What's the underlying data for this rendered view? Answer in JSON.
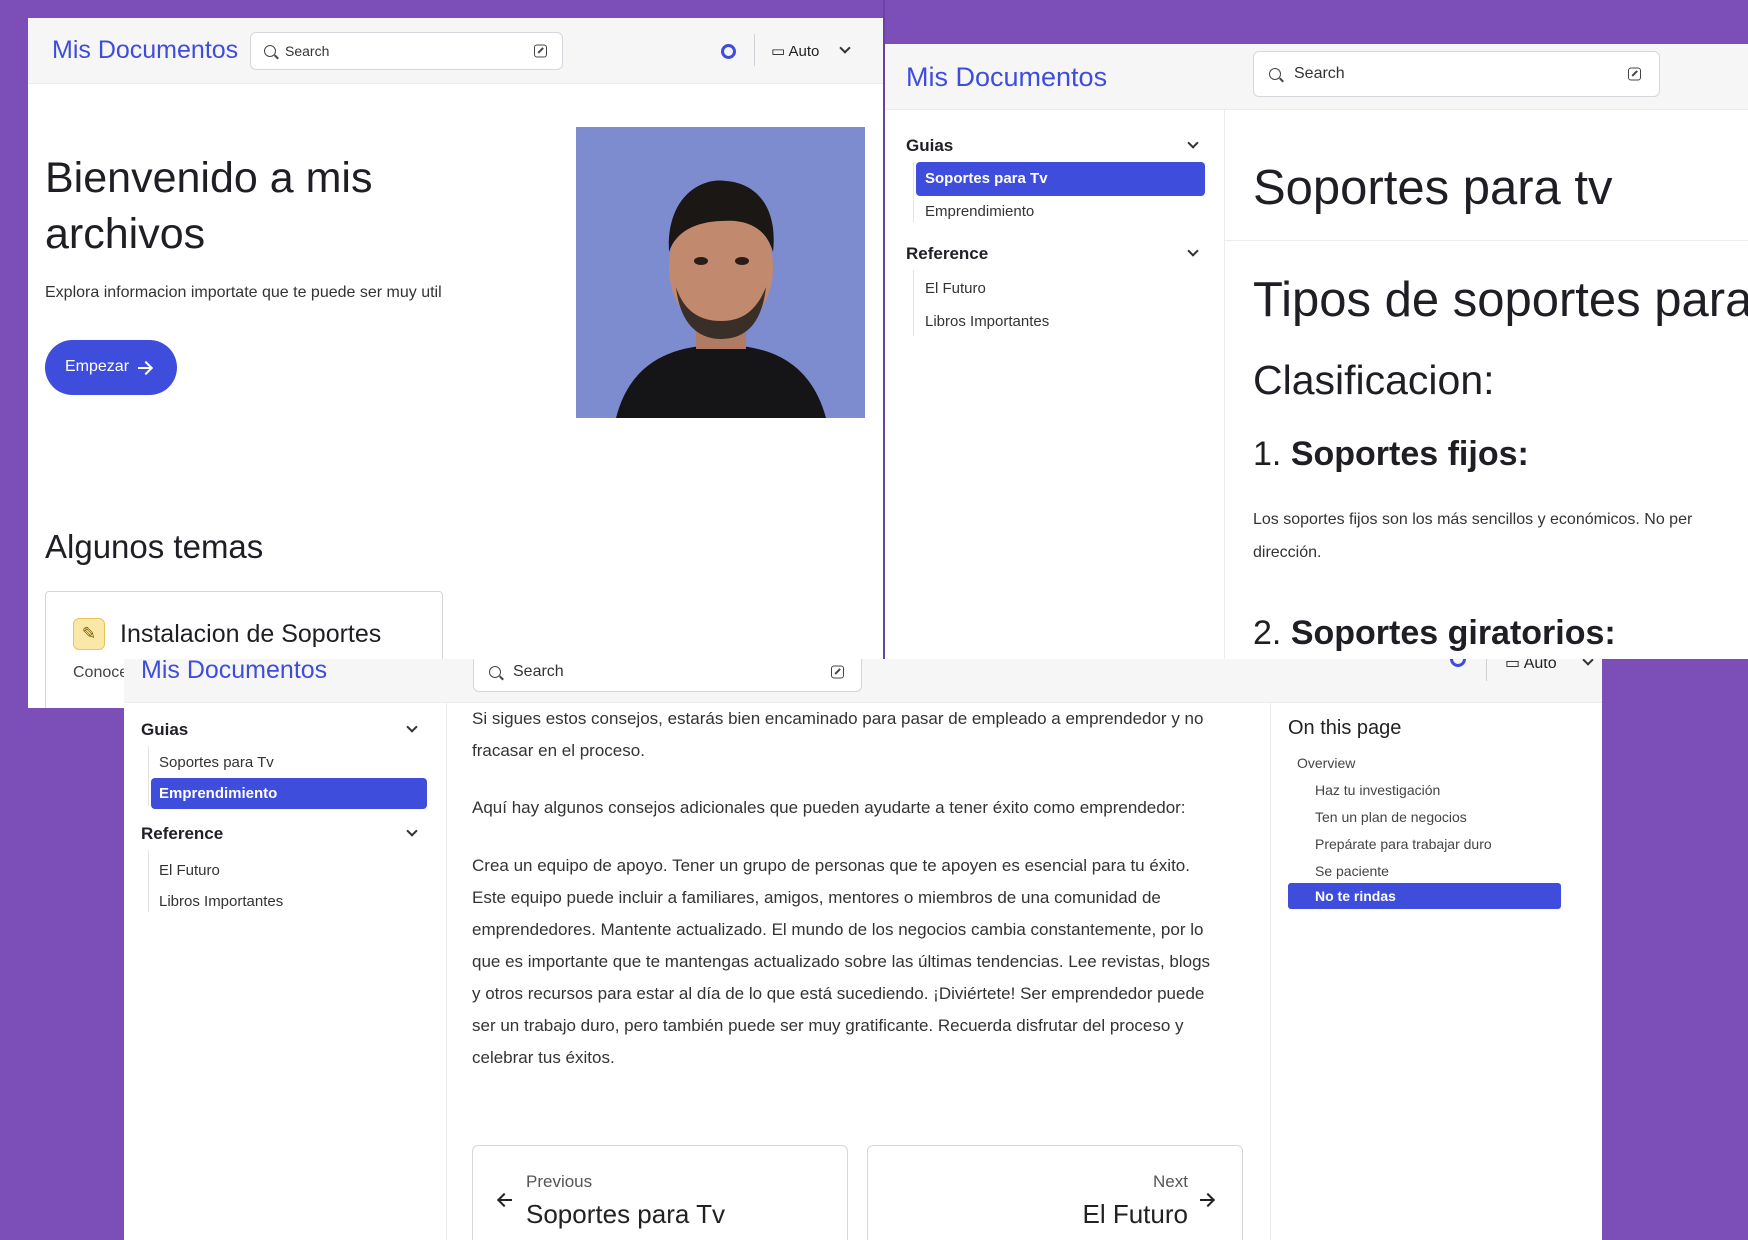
{
  "brand": "Mis Documentos",
  "search_placeholder": "Search",
  "theme_label": "Auto",
  "home": {
    "hero_title_line1": "Bienvenido a mis",
    "hero_title_line2": "archivos",
    "hero_subtitle": "Explora informacion importate que te puede ser muy util",
    "cta_label": "Empezar",
    "section_title": "Algunos temas",
    "card_title": "Instalacion de Soportes",
    "card_text": "Conoce"
  },
  "sidebar": {
    "groups": [
      {
        "label": "Guias",
        "items": [
          "Soportes para Tv",
          "Emprendimiento"
        ]
      },
      {
        "label": "Reference",
        "items": [
          "El Futuro",
          "Libros Importantes"
        ]
      }
    ]
  },
  "tv_page": {
    "title": "Soportes para tv",
    "h1": "Tipos de soportes para",
    "h2": "Clasificacion:",
    "h3_1_num": "1.",
    "h3_1_text": "Soportes fijos:",
    "p1_line1": "Los soportes fijos son los más sencillos y económicos. No per",
    "p1_line2": "dirección.",
    "h3_2_num": "2.",
    "h3_2_text": "Soportes giratorios:"
  },
  "emp_page": {
    "p1_line1": "Si sigues estos consejos, estarás bien encaminado para pasar de empleado a emprendedor y no",
    "p1_line2": "fracasar en el proceso.",
    "p2": "Aquí hay algunos consejos adicionales que pueden ayudarte a tener éxito como emprendedor:",
    "p3_lines": [
      "Crea un equipo de apoyo. Tener un grupo de personas que te apoyen es esencial para tu éxito.",
      "Este equipo puede incluir a familiares, amigos, mentores o miembros de una comunidad de",
      "emprendedores. Mantente actualizado. El mundo de los negocios cambia constantemente, por lo",
      "que es importante que te mantengas actualizado sobre las últimas tendencias. Lee revistas, blogs",
      "y otros recursos para estar al día de lo que está sucediendo. ¡Diviértete! Ser emprendedor puede",
      "ser un trabajo duro, pero también puede ser muy gratificante. Recuerda disfrutar del proceso y",
      "celebrar tus éxitos."
    ],
    "prev_label": "Previous",
    "prev_title": "Soportes para Tv",
    "next_label": "Next",
    "next_title": "El Futuro"
  },
  "toc": {
    "title": "On this page",
    "items": [
      "Overview",
      "Haz tu investigación",
      "Ten un plan de negocios",
      "Prepárate para trabajar duro",
      "Se paciente",
      "No te rindas"
    ]
  },
  "colors": {
    "accent": "#3e4ddb",
    "background": "#7c4fb8"
  },
  "icons": [
    "search-icon",
    "keyboard-shortcut-icon",
    "github-icon",
    "monitor-icon",
    "chevron-down-icon",
    "pencil-icon",
    "arrow-right-icon",
    "arrow-left-icon"
  ]
}
